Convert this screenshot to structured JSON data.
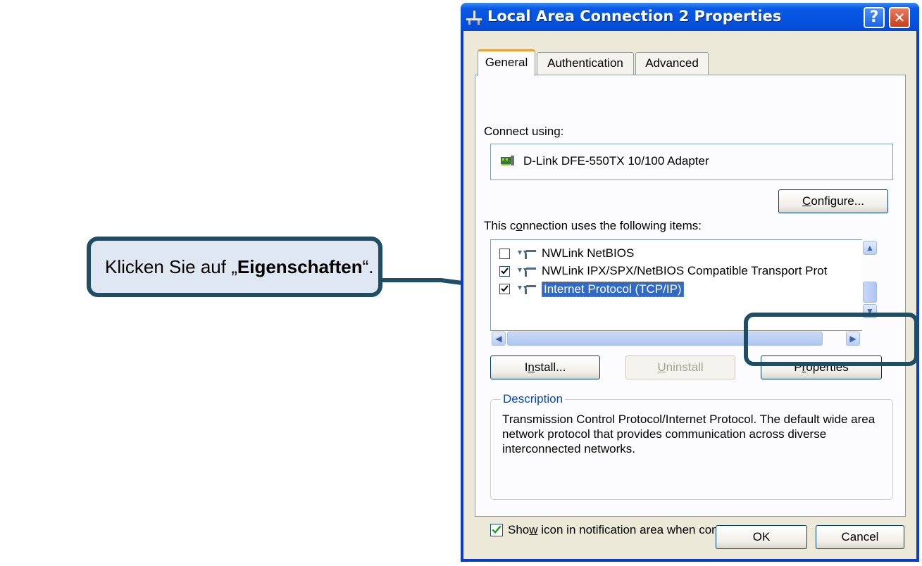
{
  "callout": {
    "prefix": "Klicken Sie auf „",
    "bold": "Eigenschaften",
    "suffix": "“."
  },
  "window": {
    "title": "Local Area Connection 2 Properties",
    "help_label": "?",
    "close_label": "✕"
  },
  "tabs": [
    {
      "label": "General",
      "active": true
    },
    {
      "label": "Authentication",
      "active": false
    },
    {
      "label": "Advanced",
      "active": false
    }
  ],
  "connect_using": {
    "label_before": "Connect using:",
    "adapter": "D-Link DFE-550TX 10/100 Adapter"
  },
  "buttons": {
    "configure": {
      "pre": "",
      "ul": "C",
      "post": "onfigure..."
    },
    "install": {
      "pre": "I",
      "ul": "n",
      "post": "stall..."
    },
    "uninstall": {
      "pre": "",
      "ul": "U",
      "post": "ninstall"
    },
    "properties": {
      "pre": "P",
      "ul": "r",
      "post": "operties"
    },
    "ok": "OK",
    "cancel": "Cancel"
  },
  "items_label": {
    "pre": "This c",
    "ul": "o",
    "post": "nnection uses the following items:"
  },
  "items": [
    {
      "label": "NWLink NetBIOS",
      "checked": false,
      "selected": false
    },
    {
      "label": "NWLink IPX/SPX/NetBIOS Compatible Transport Prot",
      "checked": true,
      "selected": false
    },
    {
      "label": "Internet Protocol (TCP/IP)",
      "checked": true,
      "selected": true
    }
  ],
  "description": {
    "title": "Description",
    "text": "Transmission Control Protocol/Internet Protocol. The default wide area network protocol that provides communication across diverse interconnected networks."
  },
  "show_icon": {
    "pre": "Sho",
    "ul": "w",
    "post": " icon in notification area when connected",
    "checked": true
  },
  "colors": {
    "callout_border": "#1f4e64",
    "callout_fill": "#dfe8f2",
    "title_bar": "#0553e0",
    "dialog_bg": "#ece9d8",
    "selection": "#316ac5"
  }
}
